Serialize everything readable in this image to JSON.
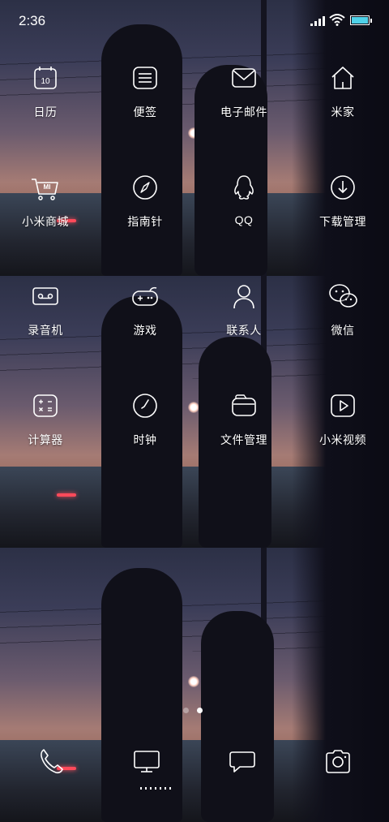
{
  "status_bar": {
    "time": "2:36",
    "battery_color": "#4fd1e8",
    "icons": [
      "signal-icon",
      "wifi-icon",
      "battery-icon"
    ]
  },
  "apps": [
    {
      "label": "日历",
      "icon": "calendar-icon",
      "icon_text": "10"
    },
    {
      "label": "便签",
      "icon": "notes-icon"
    },
    {
      "label": "电子邮件",
      "icon": "email-icon"
    },
    {
      "label": "米家",
      "icon": "home-icon"
    },
    {
      "label": "小米商城",
      "icon": "cart-icon",
      "icon_text": "MI"
    },
    {
      "label": "指南针",
      "icon": "compass-icon"
    },
    {
      "label": "QQ",
      "icon": "qq-penguin-icon"
    },
    {
      "label": "下载管理",
      "icon": "download-icon"
    },
    {
      "label": "录音机",
      "icon": "recorder-icon"
    },
    {
      "label": "游戏",
      "icon": "gamepad-icon"
    },
    {
      "label": "联系人",
      "icon": "contacts-icon"
    },
    {
      "label": "微信",
      "icon": "wechat-icon"
    },
    {
      "label": "计算器",
      "icon": "calculator-icon"
    },
    {
      "label": "时钟",
      "icon": "clock-icon"
    },
    {
      "label": "文件管理",
      "icon": "folder-icon"
    },
    {
      "label": "小米视频",
      "icon": "video-play-icon"
    }
  ],
  "pager": {
    "pages": 2,
    "active": 2
  },
  "dock": [
    {
      "icon": "phone-icon"
    },
    {
      "icon": "monitor-icon"
    },
    {
      "icon": "message-icon"
    },
    {
      "icon": "camera-icon"
    }
  ]
}
